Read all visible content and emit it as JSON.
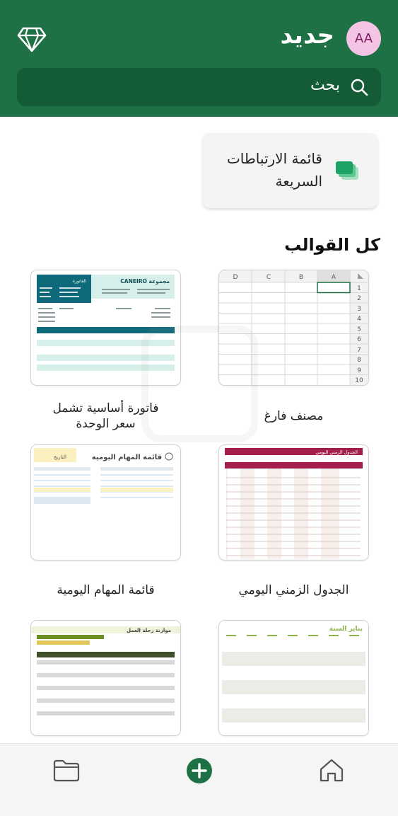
{
  "header": {
    "title": "جديد",
    "avatar_initials": "AA",
    "search_placeholder": "بحث",
    "premium_icon": "diamond-icon",
    "color": "#1e7145"
  },
  "quick_list": {
    "label_line1": "قائمة الارتباطات",
    "label_line2": "السريعة",
    "icon": "stacked-sheets-icon"
  },
  "templates_section": {
    "title": "كل القوالب",
    "items": [
      {
        "label": "مصنف فارغ"
      },
      {
        "label_line1": "فاتورة أساسية تشمل",
        "label_line2": "سعر الوحدة"
      },
      {
        "label": "الجدول الزمني اليومي"
      },
      {
        "label": "قائمة المهام اليومية"
      },
      {
        "label": ""
      },
      {
        "label": ""
      }
    ]
  },
  "thumbnails": {
    "blank_sheet": {
      "columns": [
        "D",
        "C",
        "B",
        "A"
      ],
      "rows": [
        "1",
        "2",
        "3",
        "4",
        "5",
        "6",
        "7",
        "8",
        "9",
        "10"
      ]
    },
    "invoice": {
      "title": "CANEIRO مجموعة",
      "badge": "الفاتورة"
    },
    "schedule": {
      "title": "الجدول الزمني اليومي"
    },
    "tasks": {
      "title": "قائمة المهام اليومية",
      "date_label": "التاريخ"
    },
    "trip_budget": {
      "title": "موازنة رحلة العمل"
    },
    "calendar": {
      "title": "يناير السنة"
    }
  },
  "bottom_nav": {
    "items": [
      "folder-icon",
      "add-icon",
      "home-icon"
    ],
    "accent": "#1e7145"
  }
}
